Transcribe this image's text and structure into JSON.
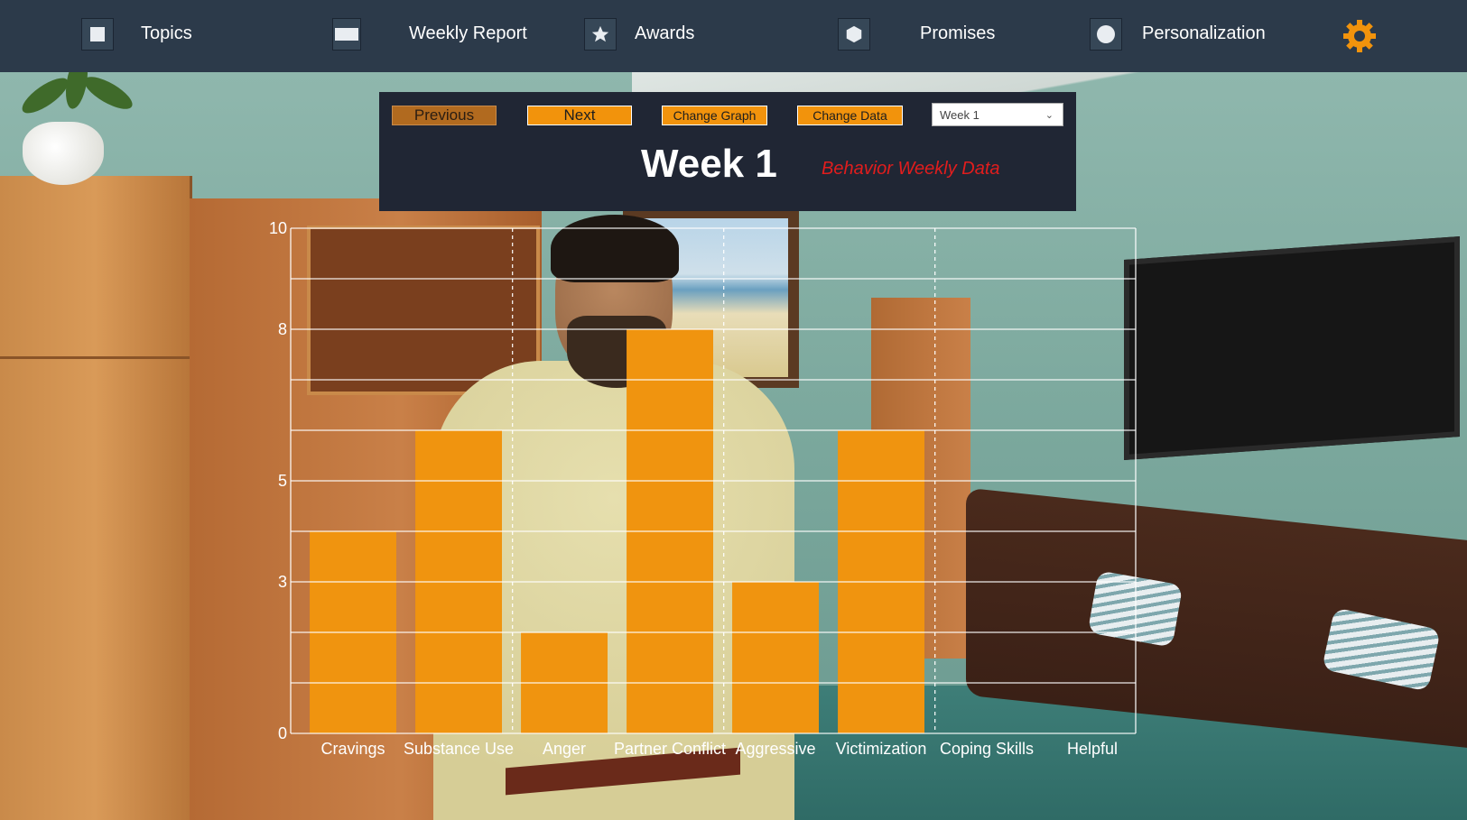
{
  "nav": {
    "items": [
      {
        "label": "Topics",
        "icon": "square-icon"
      },
      {
        "label": "Weekly Report",
        "icon": "rectangle-icon"
      },
      {
        "label": "Awards",
        "icon": "star-icon"
      },
      {
        "label": "Promises",
        "icon": "hexagon-icon"
      },
      {
        "label": "Personalization",
        "icon": "circle-icon"
      }
    ],
    "settings_icon": "gear-icon",
    "accent_color": "#f2930c"
  },
  "controls": {
    "previous_label": "Previous",
    "next_label": "Next",
    "change_graph_label": "Change Graph",
    "change_data_label": "Change Data",
    "week_select_value": "Week 1"
  },
  "header": {
    "title": "Week 1",
    "subtitle": "Behavior Weekly Data"
  },
  "chart_data": {
    "type": "bar",
    "title": "Behavior Weekly Data",
    "categories": [
      "Cravings",
      "Substance Use",
      "Anger",
      "Partner Conflict",
      "Aggressive",
      "Victimization",
      "Coping Skills",
      "Helpful"
    ],
    "values": [
      4,
      6,
      2,
      8,
      3,
      6,
      0,
      0
    ],
    "ylim": [
      0,
      10
    ],
    "y_tick_labels": [
      "0",
      "3",
      "5",
      "8",
      "10"
    ],
    "bar_color": "#f0940f",
    "grid": true
  }
}
